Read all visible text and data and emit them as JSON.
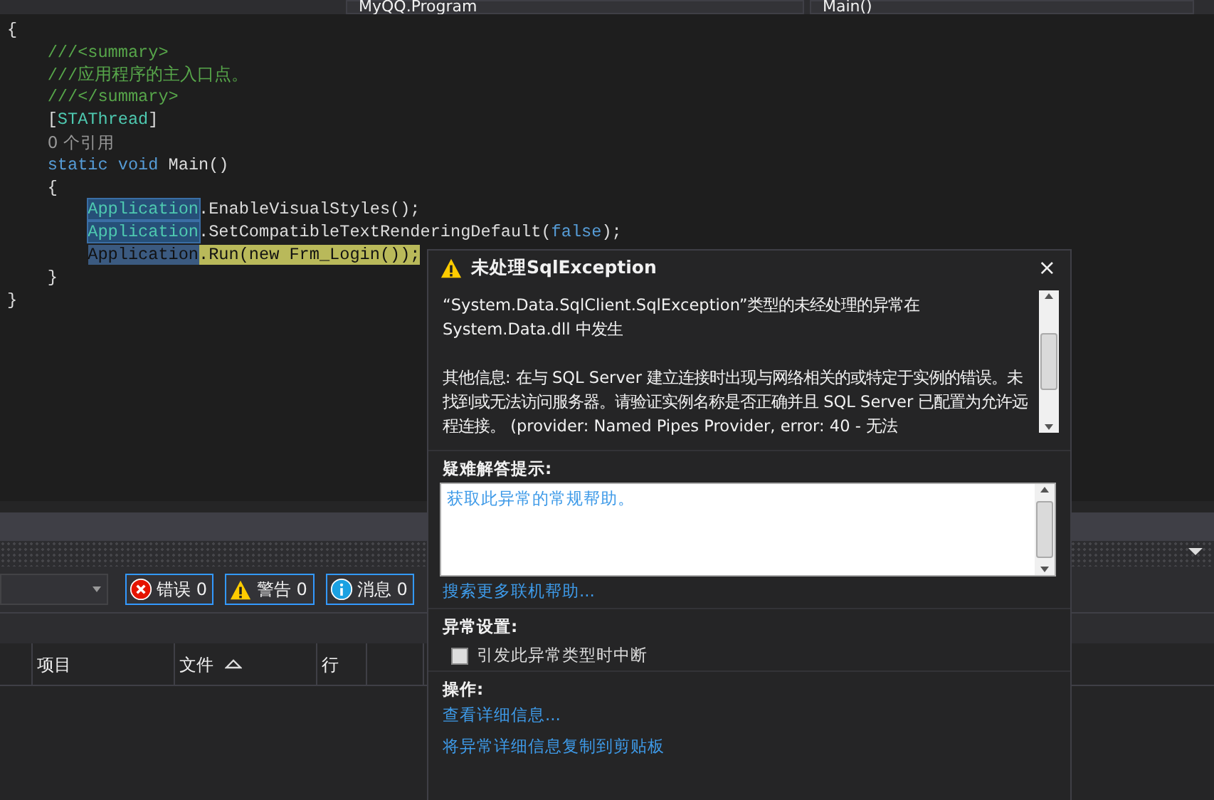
{
  "navigation_bar": {
    "class_dropdown": "MyQQ.Program",
    "member_dropdown": "Main()"
  },
  "code_lines": [
    {
      "tokens": [
        {
          "kind": "plain",
          "text": "{"
        }
      ]
    },
    {
      "tokens": [
        {
          "kind": "comment",
          "text": "    ///<summary>"
        }
      ]
    },
    {
      "tokens": [
        {
          "kind": "comment",
          "text": "    ///应用程序的主入口点。"
        }
      ]
    },
    {
      "tokens": [
        {
          "kind": "comment",
          "text": "    ///</summary>"
        }
      ]
    },
    {
      "tokens": [
        {
          "kind": "plain",
          "text": "    ["
        },
        {
          "kind": "type",
          "text": "STAThread"
        },
        {
          "kind": "plain",
          "text": "]"
        }
      ]
    },
    {
      "tokens": [
        {
          "kind": "hint",
          "text": "    0 个引用"
        }
      ]
    },
    {
      "tokens": [
        {
          "kind": "keyword",
          "text": "    static void"
        },
        {
          "kind": "plain",
          "text": " Main()"
        }
      ]
    },
    {
      "tokens": [
        {
          "kind": "plain",
          "text": "    {"
        }
      ]
    },
    {
      "tokens": [
        {
          "kind": "reference",
          "text": "        Application"
        },
        {
          "kind": "plain",
          "text": ".EnableVisualStyles();"
        }
      ]
    },
    {
      "tokens": [
        {
          "kind": "reference",
          "text": "        Application"
        },
        {
          "kind": "plain",
          "text": ".SetCompatibleTextRenderingDefault("
        },
        {
          "kind": "keyword",
          "text": "false"
        },
        {
          "kind": "plain",
          "text": ");"
        }
      ]
    },
    {
      "tokens": [
        {
          "kind": "current_reference",
          "text": "        Application"
        },
        {
          "kind": "current",
          "text": ".Run(new Frm_Login());"
        }
      ]
    },
    {
      "tokens": [
        {
          "kind": "plain",
          "text": "    }"
        }
      ]
    },
    {
      "tokens": [
        {
          "kind": "plain",
          "text": "}"
        }
      ]
    }
  ],
  "exception_helper": {
    "title": "未处理SqlException",
    "close_button": "×",
    "message": [
      "“System.Data.SqlClient.SqlException”类型的未经处理的异常在 System.Data.dll 中发生",
      "其他信息: 在与 SQL Server 建立连接时出现与网络相关的或特定于实例的错误。未找到或无法访问服务器。请验证实例名称是否正确并且 SQL Server 已配置为允许远程连接。 (provider: Named Pipes Provider, error: 40 - 无法"
    ],
    "troubleshooting_label": "疑难解答提示:",
    "troubleshooting_tips": [
      "获取此异常的常规帮助。"
    ],
    "search_link": "搜索更多联机帮助...",
    "settings_label": "异常设置:",
    "break_checkbox": {
      "label": "引发此异常类型时中断",
      "checked": false
    },
    "actions_label": "操作:",
    "actions": [
      "查看详细信息...",
      "将异常详细信息复制到剪贴板"
    ]
  },
  "error_list": {
    "filters": [
      {
        "kind": "error",
        "label": "错误 0",
        "selected": true
      },
      {
        "kind": "warning",
        "label": "警告 0",
        "selected": true
      },
      {
        "kind": "info",
        "label": "消息 0",
        "selected": true
      }
    ],
    "columns": [
      {},
      {
        "label": "项目"
      },
      {
        "label": "文件",
        "sorted": true
      },
      {
        "label": "行"
      },
      {}
    ]
  }
}
